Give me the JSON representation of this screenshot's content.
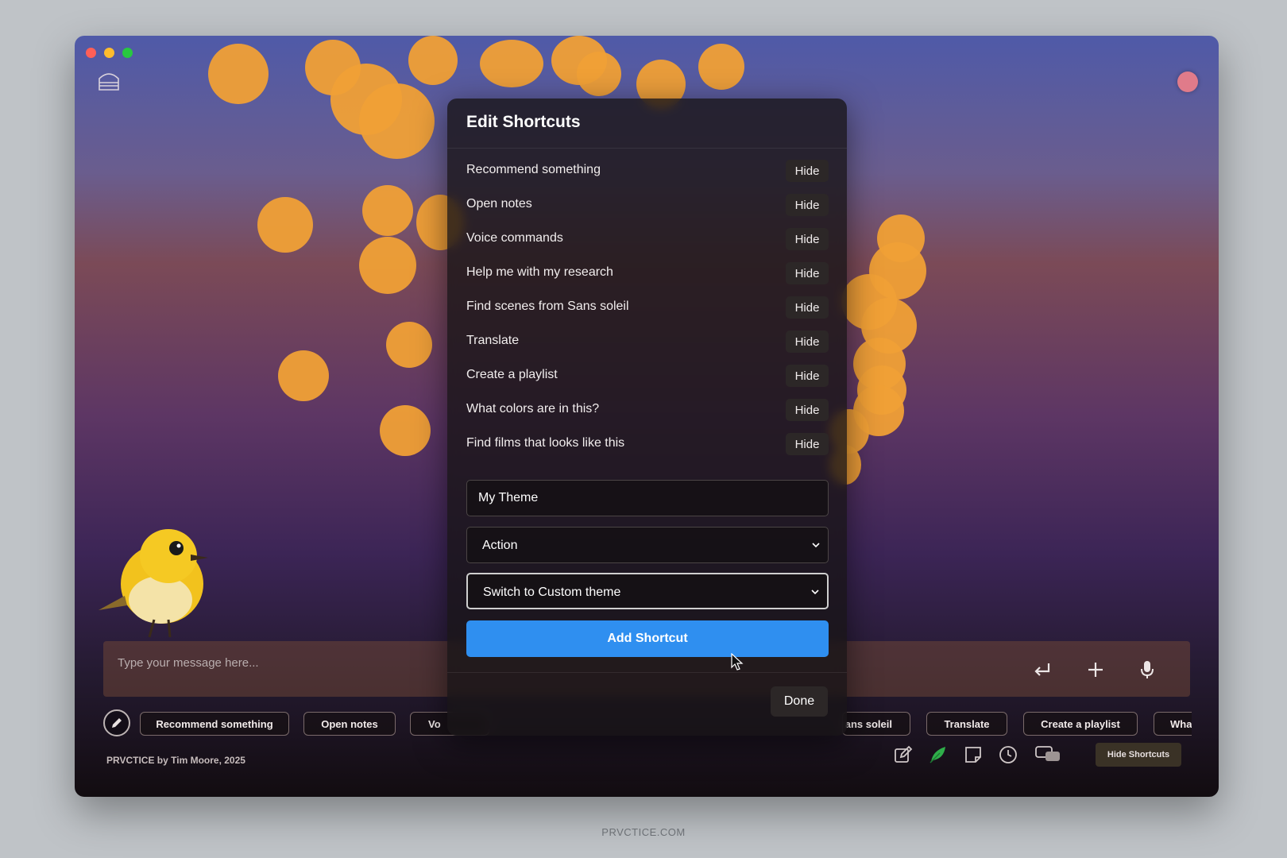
{
  "modal": {
    "title": "Edit Shortcuts",
    "shortcuts": [
      {
        "label": "Recommend something",
        "action_label": "Hide"
      },
      {
        "label": "Open notes",
        "action_label": "Hide"
      },
      {
        "label": "Voice commands",
        "action_label": "Hide"
      },
      {
        "label": "Help me with my research",
        "action_label": "Hide"
      },
      {
        "label": "Find scenes from Sans soleil",
        "action_label": "Hide"
      },
      {
        "label": "Translate",
        "action_label": "Hide"
      },
      {
        "label": "Create a playlist",
        "action_label": "Hide"
      },
      {
        "label": "What colors are in this?",
        "action_label": "Hide"
      },
      {
        "label": "Find films that looks like this",
        "action_label": "Hide"
      }
    ],
    "name_field_value": "My Theme",
    "type_select_value": "Action",
    "action_select_value": "Switch to Custom theme",
    "add_button_label": "Add Shortcut",
    "done_button_label": "Done"
  },
  "composer": {
    "placeholder": "Type your message here..."
  },
  "chips": {
    "recommend": "Recommend something",
    "open_notes": "Open notes",
    "voice_partial": "Vo",
    "sans_soleil_partial": "ans soleil",
    "translate": "Translate",
    "playlist": "Create a playlist",
    "what_partial": "What"
  },
  "footer": {
    "credit": "PRVCTICE by Tim Moore, 2025",
    "hide_shortcuts_label": "Hide Shortcuts"
  },
  "site_label": "PRVCTICE.COM",
  "colors": {
    "accent": "#2f8ff0",
    "traffic_red": "#ff5f57",
    "traffic_yellow": "#febc2e",
    "traffic_green": "#28c840",
    "bokeh": "#f0a036",
    "record": "#e07b8a",
    "feather": "#2fae4a"
  },
  "icons": [
    "app-logo-icon",
    "record-icon",
    "enter-icon",
    "plus-icon",
    "mic-icon",
    "pencil-icon",
    "edit-icon",
    "feather-icon",
    "note-icon",
    "clock-icon",
    "chat-icon",
    "chevron-down-icon",
    "cursor-icon"
  ]
}
